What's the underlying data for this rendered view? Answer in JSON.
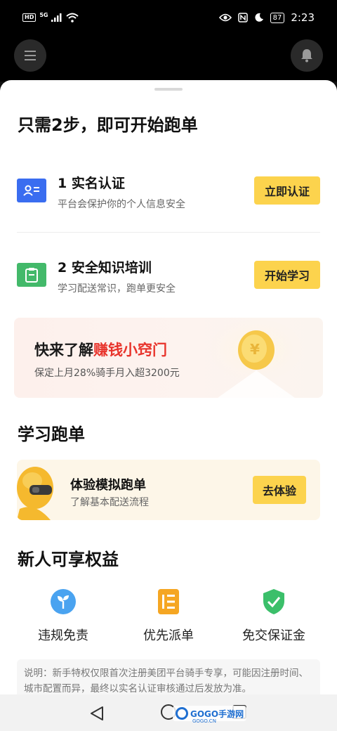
{
  "status_bar": {
    "hd": "HD",
    "network": "5G",
    "battery": "87",
    "time": "2:23"
  },
  "steps_section": {
    "title": "只需2步，即可开始跑单",
    "steps": [
      {
        "title": "1 实名认证",
        "subtitle": "平台会保护你的个人信息安全",
        "button": "立即认证",
        "icon": "id-card-icon",
        "color": "#3a6df0"
      },
      {
        "title": "2 安全知识培训",
        "subtitle": "学习配送常识，跑单更安全",
        "button": "开始学习",
        "icon": "clipboard-icon",
        "color": "#43b96a"
      }
    ]
  },
  "promo": {
    "title_prefix": "快来了解",
    "title_highlight": "赚钱小窍门",
    "subtitle": "保定上月28%骑手月入超3200元",
    "highlight_color": "#e8342c"
  },
  "learn_section": {
    "title": "学习跑单",
    "card_title": "体验模拟跑单",
    "card_subtitle": "了解基本配送流程",
    "button": "去体验"
  },
  "benefits_section": {
    "title": "新人可享权益",
    "items": [
      {
        "label": "违规免责",
        "icon": "sprout-icon",
        "color": "#4aa3f0"
      },
      {
        "label": "优先派单",
        "icon": "list-priority-icon",
        "color": "#f5a623"
      },
      {
        "label": "免交保证金",
        "icon": "shield-check-icon",
        "color": "#3bbf6a"
      }
    ]
  },
  "note": {
    "text": "说明：新手特权仅限首次注册美团平台骑手专享，可能因注册时间、城市配置而异，最终以实名认证审核通过后发放为准。"
  },
  "watermark": {
    "text": "GOGO手游网",
    "sub": "GOGO.CN"
  },
  "colors": {
    "accent_yellow": "#fcd34d",
    "sheet_bg": "#ffffff"
  }
}
